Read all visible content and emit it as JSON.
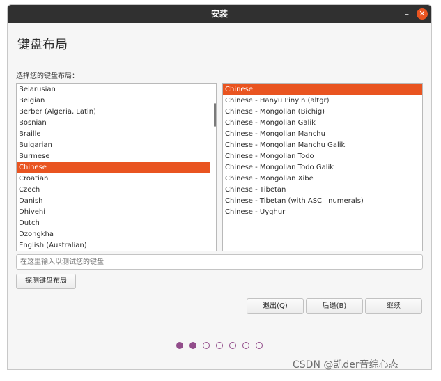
{
  "window": {
    "title": "安装"
  },
  "page": {
    "heading": "键盘布局",
    "list_caption": "选择您的键盘布局："
  },
  "layouts": [
    "Belarusian",
    "Belgian",
    "Berber (Algeria, Latin)",
    "Bosnian",
    "Braille",
    "Bulgarian",
    "Burmese",
    "Chinese",
    "Croatian",
    "Czech",
    "Danish",
    "Dhivehi",
    "Dutch",
    "Dzongkha",
    "English (Australian)"
  ],
  "layout_selected_index": 7,
  "variants": [
    "Chinese",
    "Chinese - Hanyu Pinyin (altgr)",
    "Chinese - Mongolian (Bichig)",
    "Chinese - Mongolian Galik",
    "Chinese - Mongolian Manchu",
    "Chinese - Mongolian Manchu Galik",
    "Chinese - Mongolian Todo",
    "Chinese - Mongolian Todo Galik",
    "Chinese - Mongolian Xibe",
    "Chinese - Tibetan",
    "Chinese - Tibetan (with ASCII numerals)",
    "Chinese - Uyghur"
  ],
  "variant_selected_index": 0,
  "test_input": {
    "placeholder": "在这里输入以测试您的键盘",
    "value": ""
  },
  "buttons": {
    "detect": "探测键盘布局",
    "quit": "退出(Q)",
    "back": "后退(B)",
    "continue": "继续"
  },
  "progress": {
    "total": 7,
    "completed": 2
  },
  "titlebar_icons": {
    "minimize": "minimize-icon",
    "close": "close-icon"
  },
  "colors": {
    "accent": "#e95420",
    "progress": "#924d8b",
    "titlebar": "#303030"
  },
  "watermark": "CSDN @凯der音综心态"
}
